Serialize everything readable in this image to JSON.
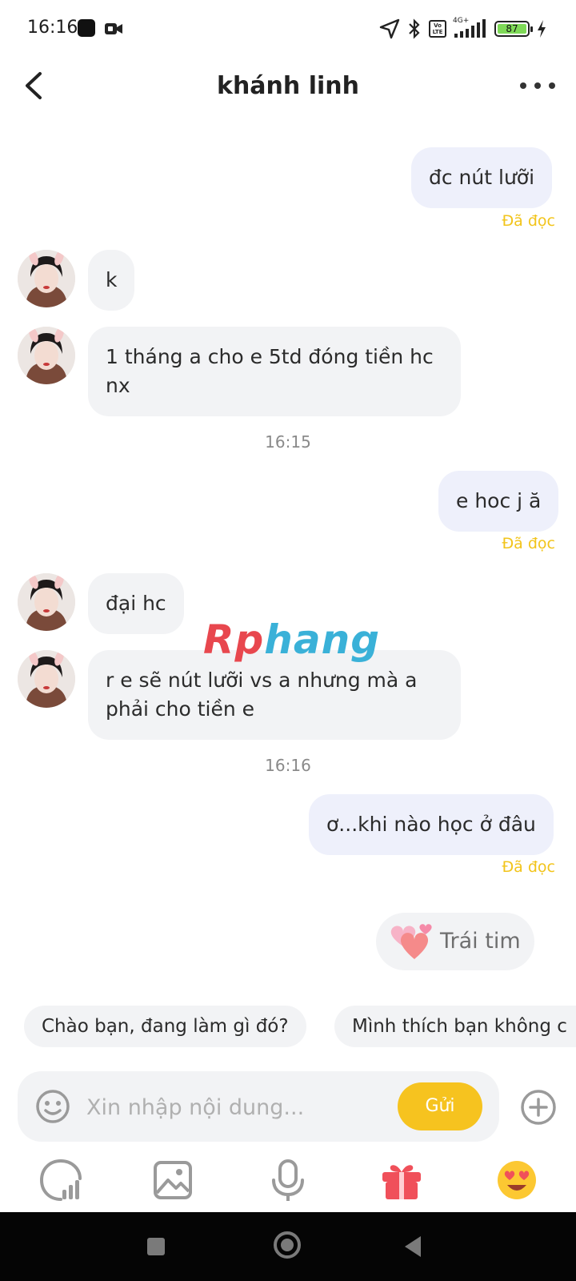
{
  "status_bar": {
    "time": "16:16",
    "network": "4G+",
    "volte": "Vo LTE",
    "battery": "87"
  },
  "header": {
    "title": "khánh linh",
    "back_icon": "chevron-left-icon",
    "more_icon": "more-horizontal-icon"
  },
  "messages": [
    {
      "dir": "out",
      "text": "đc nút lưỡi",
      "status": "Đã đọc"
    },
    {
      "dir": "in",
      "text": "k"
    },
    {
      "dir": "in",
      "text_lines": [
        "1 tháng a cho e 5td đóng tiền hc",
        "nx"
      ]
    },
    {
      "time": "16:15"
    },
    {
      "dir": "out",
      "text": "e hoc j ă",
      "status": "Đã đọc"
    },
    {
      "dir": "in",
      "text": "đại hc"
    },
    {
      "dir": "in",
      "text_lines": [
        "r e sẽ nút lưỡi vs a nhưng mà a",
        "phải cho tiền e"
      ]
    },
    {
      "time": "16:16"
    },
    {
      "dir": "out",
      "text": "ơ...khi nào học ở đâu",
      "status": "Đã đọc"
    }
  ],
  "watermark": {
    "part_a": "Rp",
    "part_b": "hang"
  },
  "heart_chip": {
    "label": "Trái tim",
    "icon": "hearts-icon"
  },
  "quick_replies": [
    "Chào bạn,  đang làm gì đó?",
    "Mình thích bạn không c"
  ],
  "input": {
    "placeholder": "Xin nhập nội dung...",
    "send_label": "Gửi",
    "emoji_icon": "smiley-icon",
    "plus_icon": "plus-circle-icon"
  },
  "toolbar": [
    "stats-icon",
    "image-icon",
    "microphone-icon",
    "gift-icon",
    "heart-eyes-emoji-icon"
  ],
  "colors": {
    "accent": "#f6c31f",
    "read_status": "#f2c41b",
    "outgoing_bubble": "#eef0fb",
    "incoming_bubble": "#f2f3f5",
    "gift": "#f0505a"
  }
}
